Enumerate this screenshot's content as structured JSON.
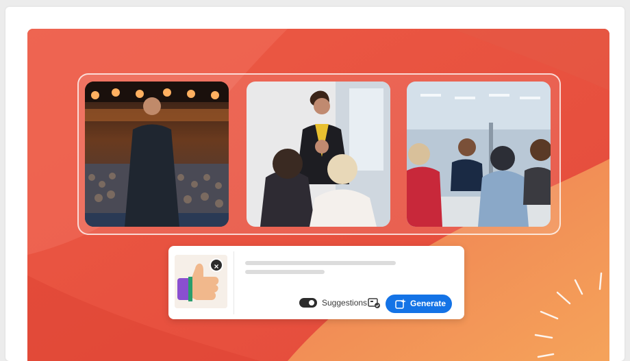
{
  "prompt_bar": {
    "suggestions_label": "Suggestions",
    "generate_label": "Generate",
    "close_symbol": "×"
  },
  "photos": [
    {
      "icon": "speaker-on-stage-photo"
    },
    {
      "icon": "presenter-meeting-photo"
    },
    {
      "icon": "office-team-photo"
    }
  ],
  "colors": {
    "hero_red": "#e8543e",
    "hero_orange": "#f39a55",
    "generate_blue": "#1473e6"
  }
}
